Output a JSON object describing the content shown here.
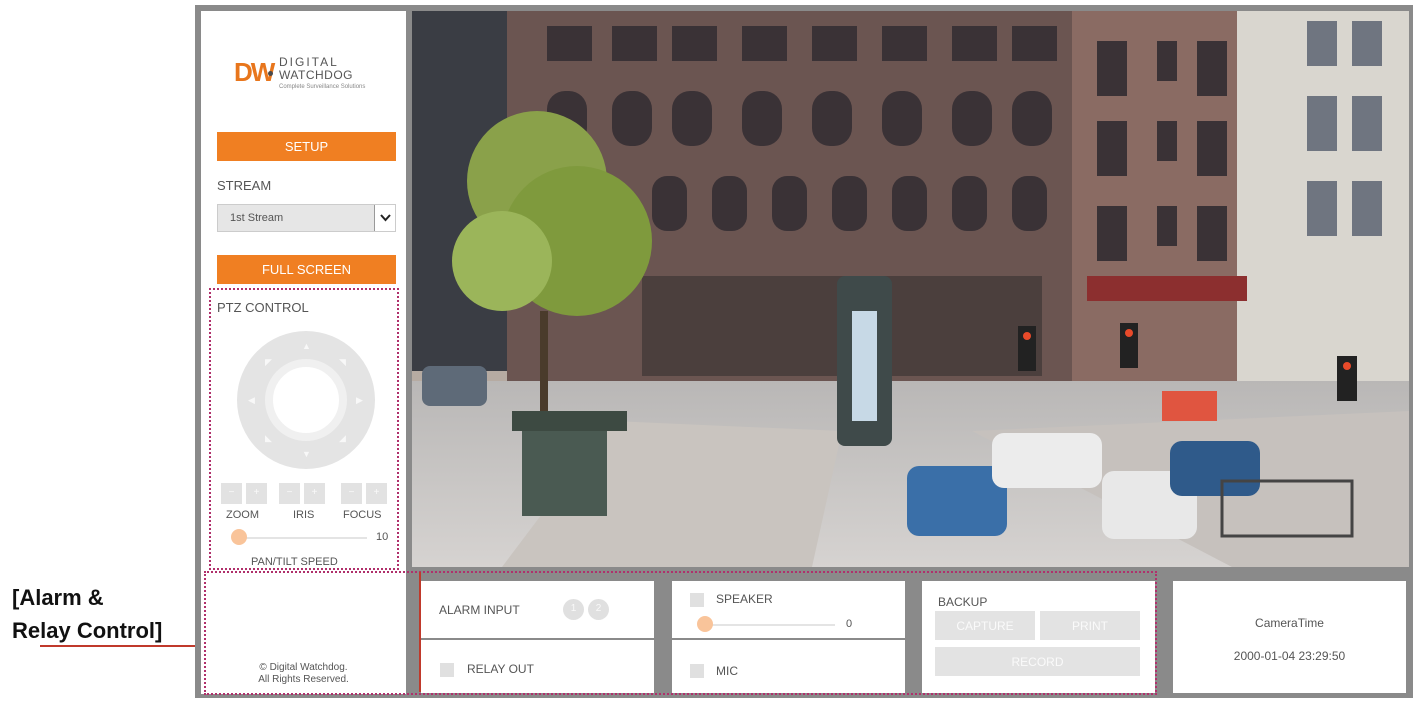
{
  "sidebar": {
    "logo": {
      "mark": "DW",
      "line1": "DIGITAL",
      "line2": "WATCHDOG",
      "tagline": "Complete Surveillance Solutions"
    },
    "setup_label": "SETUP",
    "stream_label": "STREAM",
    "stream_value": "1st Stream",
    "fullscreen_label": "FULL SCREEN",
    "ptz": {
      "title": "PTZ CONTROL",
      "zoom_label": "ZOOM",
      "iris_label": "IRIS",
      "focus_label": "FOCUS",
      "speed_label": "PAN/TILT SPEED",
      "speed_value": "10",
      "speed_level": 0.0
    },
    "copyright_line1": "© Digital Watchdog.",
    "copyright_line2": "All Rights Reserved."
  },
  "alarm": {
    "input_label": "ALARM INPUT",
    "input_indicators": [
      "1",
      "2"
    ],
    "relay_label": "RELAY OUT"
  },
  "audio": {
    "speaker_label": "SPEAKER",
    "speaker_value": "0",
    "speaker_level": 0.0,
    "mic_label": "MIC"
  },
  "backup": {
    "title": "BACKUP",
    "capture_label": "CAPTURE",
    "print_label": "PRINT",
    "record_label": "RECORD"
  },
  "camera_time": {
    "title": "CameraTime",
    "value": "2000-01-04 23:29:50"
  },
  "annotation": {
    "line1": "[Alarm &",
    "line2": "Relay Control]"
  },
  "colors": {
    "accent": "#f07f22",
    "frame": "#8a8a8a",
    "highlight_border": "#b0306b",
    "callout_line": "#c0392b"
  }
}
